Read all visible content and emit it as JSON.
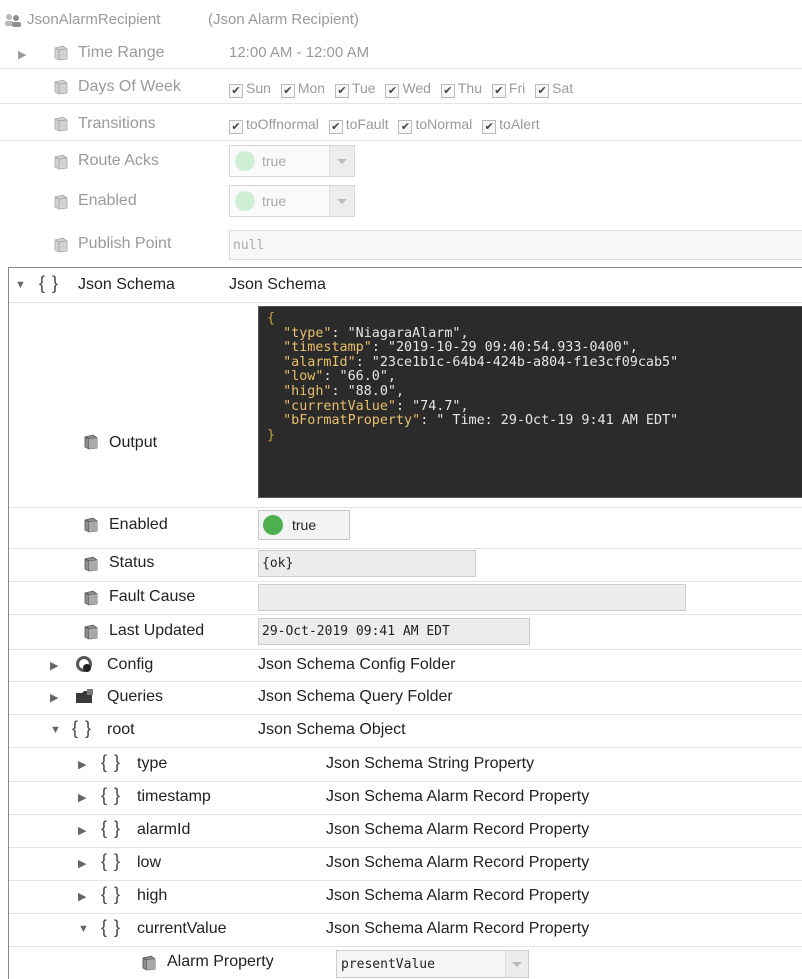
{
  "header": {
    "name": "JsonAlarmRecipient",
    "type": "(Json Alarm Recipient)"
  },
  "props": {
    "time_range": {
      "label": "Time Range",
      "value": "12:00 AM - 12:00 AM"
    },
    "days_of_week": {
      "label": "Days Of Week",
      "days": [
        "Sun",
        "Mon",
        "Tue",
        "Wed",
        "Thu",
        "Fri",
        "Sat"
      ]
    },
    "transitions": {
      "label": "Transitions",
      "items": [
        "toOffnormal",
        "toFault",
        "toNormal",
        "toAlert"
      ]
    },
    "route_acks": {
      "label": "Route Acks",
      "value": "true"
    },
    "enabled": {
      "label": "Enabled",
      "value": "true"
    },
    "publish_point": {
      "label": "Publish Point",
      "value": "null"
    }
  },
  "schema": {
    "label": "Json Schema",
    "type": "Json Schema",
    "output_label": "Output",
    "json_lines": [
      {
        "key": "",
        "text": "{"
      },
      {
        "key": "\"type\"",
        "text": ": \"NiagaraAlarm\","
      },
      {
        "key": "\"timestamp\"",
        "text": ": \"2019-10-29 09:40:54.933-0400\","
      },
      {
        "key": "\"alarmId\"",
        "text": ": \"23ce1b1c-64b4-424b-a804-f1e3cf09cab5\""
      },
      {
        "key": "\"low\"",
        "text": ": \"66.0\","
      },
      {
        "key": "\"high\"",
        "text": ": \"88.0\","
      },
      {
        "key": "\"currentValue\"",
        "text": ": \"74.7\","
      },
      {
        "key": "\"bFormatProperty\"",
        "text": ": \" Time: 29-Oct-19 9:41 AM EDT\""
      },
      {
        "key": "",
        "text": "}"
      }
    ],
    "enabled_label": "Enabled",
    "enabled_value": "true",
    "status_label": "Status",
    "status_value": "{ok}",
    "fault_label": "Fault Cause",
    "fault_value": "",
    "last_updated_label": "Last Updated",
    "last_updated_value": "29-Oct-2019 09:41 AM EDT",
    "config": {
      "label": "Config",
      "type": "Json Schema Config Folder"
    },
    "queries": {
      "label": "Queries",
      "type": "Json Schema Query Folder"
    },
    "root": {
      "label": "root",
      "type": "Json Schema Object"
    },
    "children": [
      {
        "label": "type",
        "type": "Json Schema String Property"
      },
      {
        "label": "timestamp",
        "type": "Json Schema Alarm Record Property"
      },
      {
        "label": "alarmId",
        "type": "Json Schema Alarm Record Property"
      },
      {
        "label": "low",
        "type": "Json Schema Alarm Record Property"
      },
      {
        "label": "high",
        "type": "Json Schema Alarm Record Property"
      },
      {
        "label": "currentValue",
        "type": "Json Schema Alarm Record Property"
      }
    ],
    "alarm_property": {
      "label": "Alarm Property",
      "value": "presentValue"
    }
  },
  "colors": {
    "ok_green": "#4caf50",
    "code_bg": "#2b2b2b",
    "json_key": "#e8bf6a"
  },
  "icons": {
    "slot": "slot-icon",
    "component": "users-icon",
    "config": "gear-icon",
    "folder": "folder-icon"
  }
}
